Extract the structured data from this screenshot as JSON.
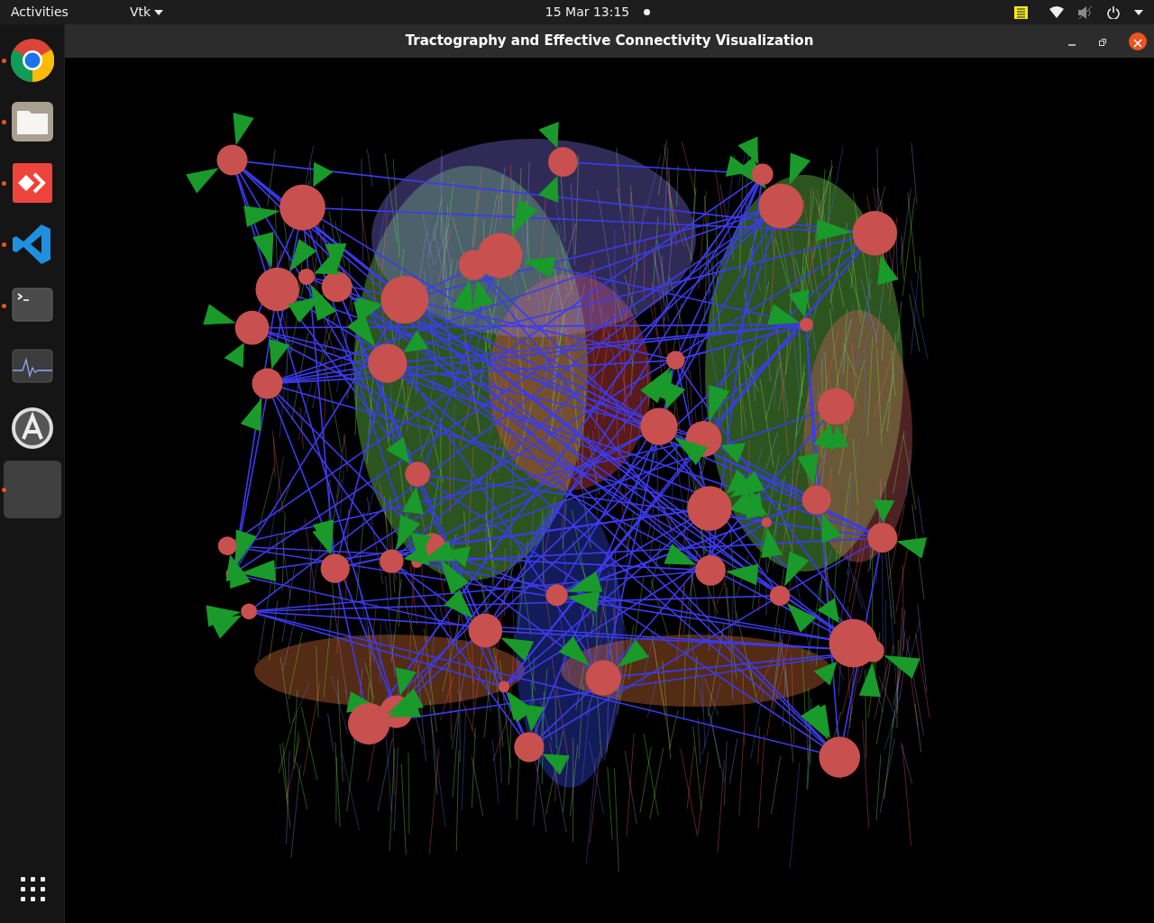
{
  "top_bar": {
    "activities": "Activities",
    "app_menu": "Vtk",
    "clock": "15 Mar  13:15"
  },
  "dock": {
    "items": [
      {
        "kind": "chrome",
        "running": true,
        "selected": false
      },
      {
        "kind": "files",
        "running": true,
        "selected": false
      },
      {
        "kind": "anydesk",
        "running": true,
        "selected": false
      },
      {
        "kind": "vscode",
        "running": true,
        "selected": false
      },
      {
        "kind": "terminal",
        "running": true,
        "selected": false
      },
      {
        "kind": "monitor",
        "running": false,
        "selected": false
      },
      {
        "kind": "updater",
        "running": false,
        "selected": false
      },
      {
        "kind": "blank",
        "running": true,
        "selected": true
      }
    ]
  },
  "window": {
    "title": "Tractography and Effective Connectivity Visualization"
  }
}
